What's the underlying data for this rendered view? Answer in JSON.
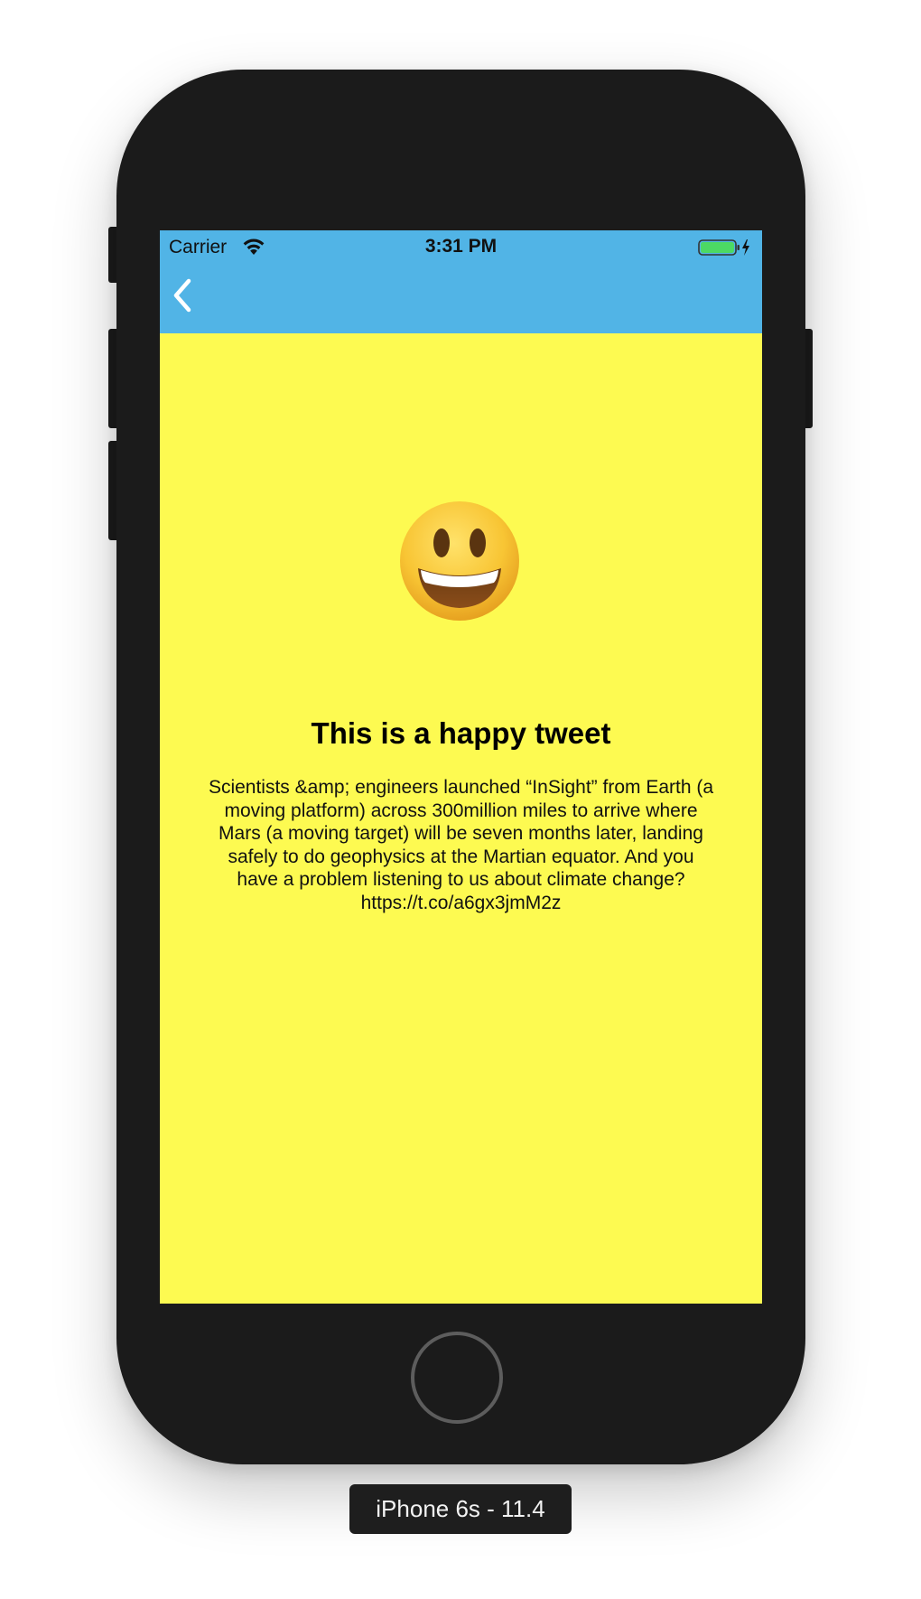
{
  "status_bar": {
    "carrier": "Carrier",
    "time": "3:31 PM",
    "wifi_icon": "wifi-icon",
    "battery_icon": "battery-charging-icon",
    "battery_level": 1.0
  },
  "nav": {
    "back_icon": "chevron-left-icon",
    "color": "#51b4e6"
  },
  "tweet": {
    "emoji_icon": "smiling-face-emoji",
    "title": "This is a happy tweet",
    "text": "Scientists &amp; engineers launched “InSight” from Earth (a moving platform) across 300million miles to arrive where Mars (a moving target) will be seven months later, landing safely to do geophysics at the Martian equator. And you have a problem listening to us about climate change? https://t.co/a6gx3jmM2z",
    "background": "#fdfa51"
  },
  "device": {
    "label": "iPhone 6s - 11.4",
    "home_button_icon": "home-button"
  }
}
